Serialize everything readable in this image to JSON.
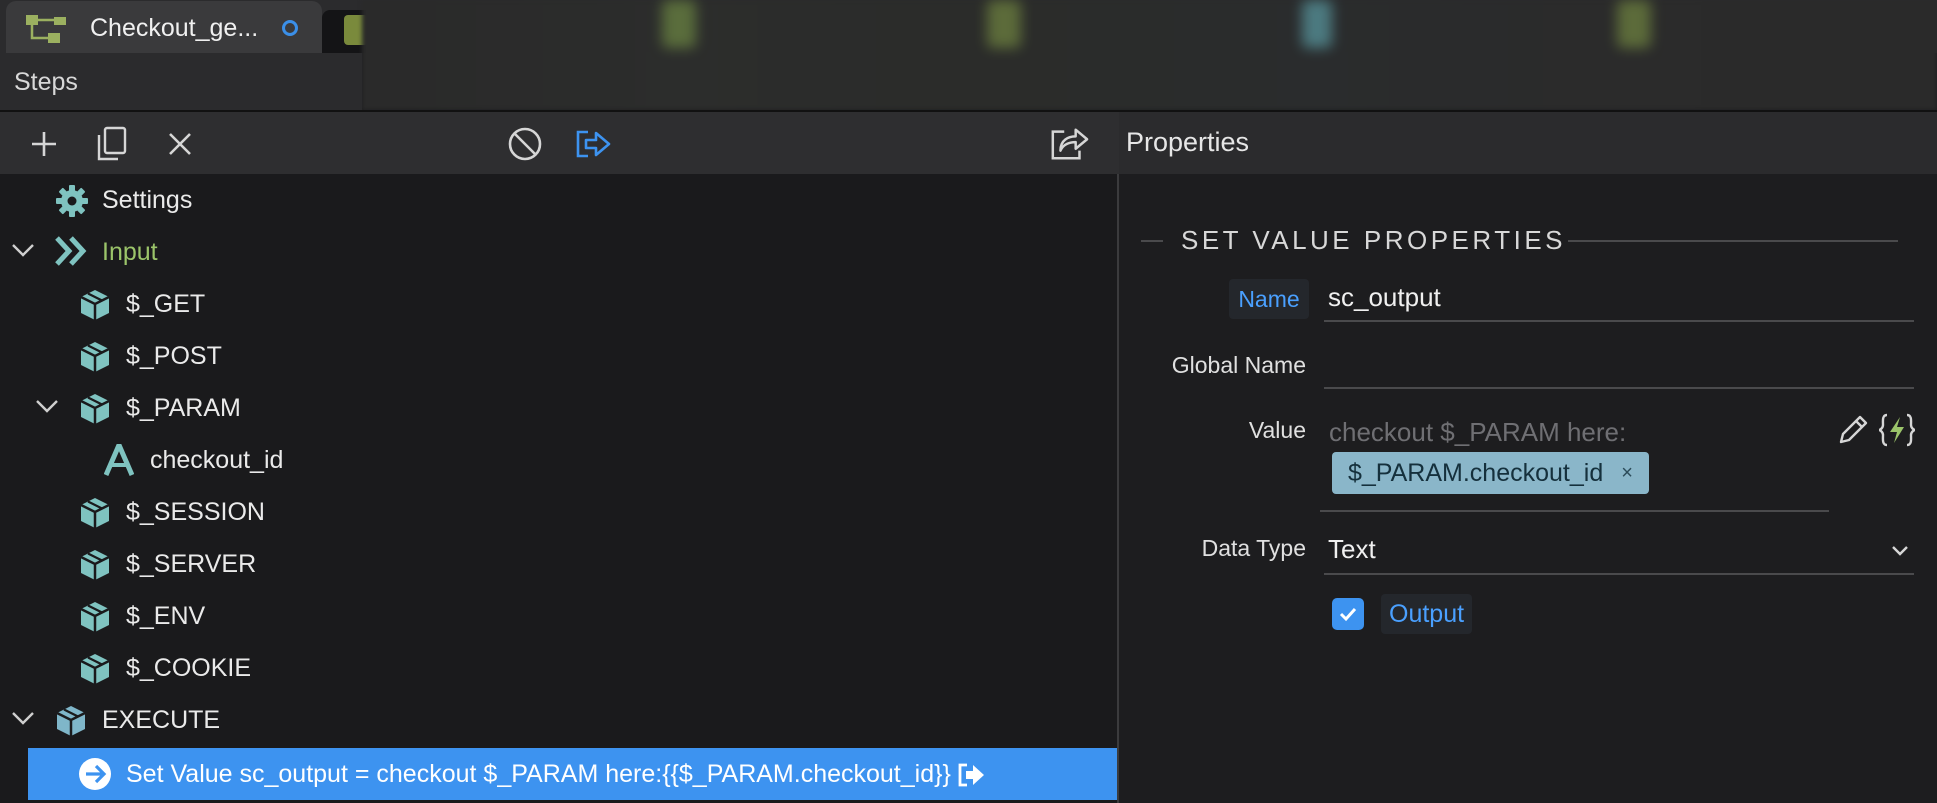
{
  "tabs": {
    "active": {
      "title": "Checkout_ge...",
      "icon": "flow-tree-icon"
    },
    "second": {
      "icon": "json-file-icon"
    }
  },
  "steps_header": {
    "label": "Steps"
  },
  "toolbar": {
    "buttons": [
      "add-icon",
      "copy-icon",
      "delete-icon",
      "disable-icon",
      "output-step-icon",
      "share-icon"
    ]
  },
  "properties_header": {
    "label": "Properties"
  },
  "tree": {
    "settings": {
      "label": "Settings"
    },
    "input": {
      "label": "Input",
      "color": "#9bc46a"
    },
    "get": {
      "label": "$_GET"
    },
    "post": {
      "label": "$_POST"
    },
    "param": {
      "label": "$_PARAM"
    },
    "checkout_id": {
      "label": "checkout_id"
    },
    "session": {
      "label": "$_SESSION"
    },
    "server": {
      "label": "$_SERVER"
    },
    "env": {
      "label": "$_ENV"
    },
    "cookie": {
      "label": "$_COOKIE"
    },
    "execute": {
      "label": "EXECUTE"
    },
    "set_value": {
      "label": "Set Value sc_output = checkout $_PARAM here:{{$_PARAM.checkout_id}}"
    }
  },
  "properties": {
    "section_title": "SET VALUE PROPERTIES",
    "name": {
      "label": "Name",
      "value": "sc_output"
    },
    "global_name": {
      "label": "Global Name",
      "value": ""
    },
    "value": {
      "label": "Value",
      "placeholder": "checkout $_PARAM here:",
      "token": "$_PARAM.checkout_id",
      "token_remove": "×"
    },
    "data_type": {
      "label": "Data Type",
      "selected": "Text"
    },
    "output": {
      "label": "Output",
      "checked": true
    }
  },
  "colors": {
    "accent": "#3d93f0",
    "icon_teal": "#7fc3c0",
    "input_green": "#9bc46a"
  }
}
